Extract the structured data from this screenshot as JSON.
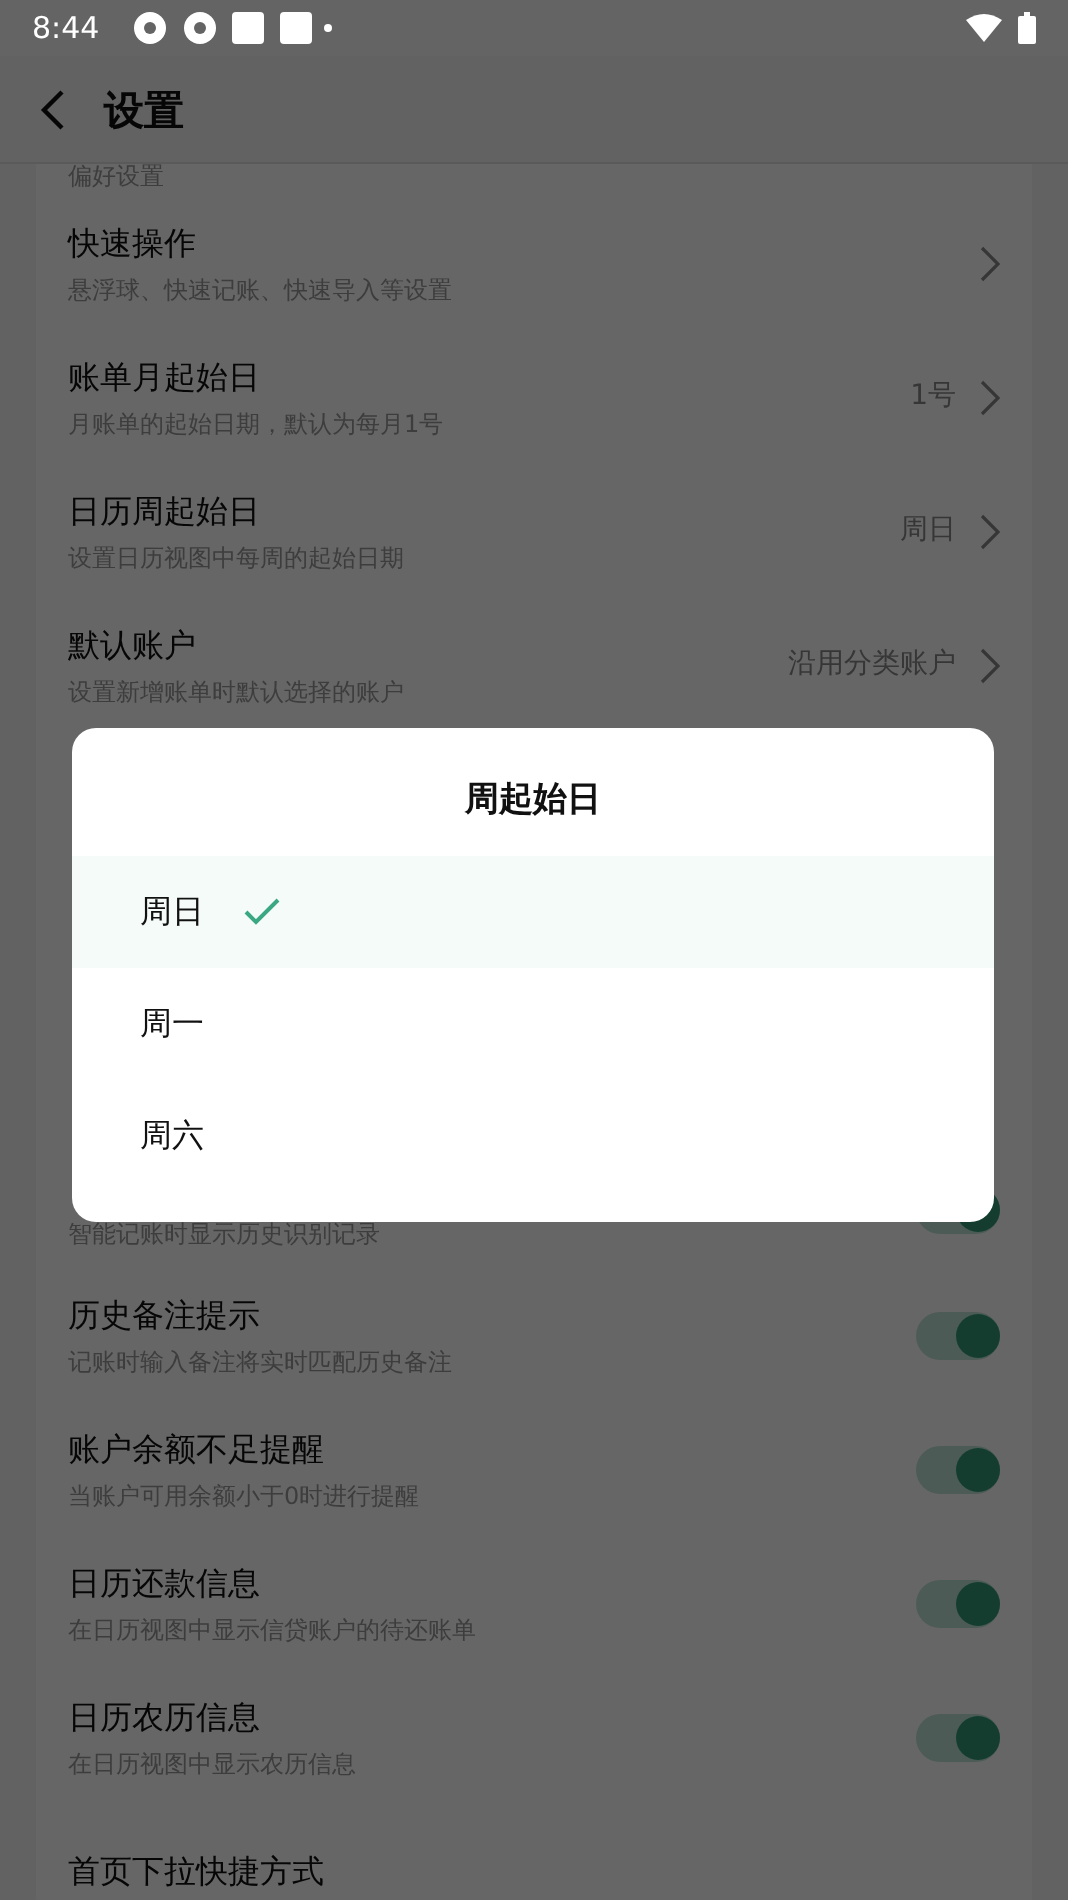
{
  "status_bar": {
    "time": "8:44"
  },
  "app_bar": {
    "title": "设置"
  },
  "section_header": "偏好设置",
  "arrow_rows": [
    {
      "title": "快速操作",
      "subtitle": "悬浮球、快速记账、快速导入等设置"
    },
    {
      "title": "账单月起始日",
      "subtitle": "月账单的起始日期，默认为每月1号",
      "value": "1号"
    },
    {
      "title": "日历周起始日",
      "subtitle": "设置日历视图中每周的起始日期",
      "value": "周日"
    },
    {
      "title": "默认账户",
      "subtitle": "设置新增账单时默认选择的账户",
      "value": "沿用分类账户"
    }
  ],
  "toggle_rows": [
    {
      "subtitle": "智能记账时显示历史识别记录",
      "on": true
    },
    {
      "title": "历史备注提示",
      "subtitle": "记账时输入备注将实时匹配历史备注",
      "on": true
    },
    {
      "title": "账户余额不足提醒",
      "subtitle": "当账户可用余额小于0时进行提醒",
      "on": true
    },
    {
      "title": "日历还款信息",
      "subtitle": "在日历视图中显示信贷账户的待还账单",
      "on": true
    },
    {
      "title": "日历农历信息",
      "subtitle": "在日历视图中显示农历信息",
      "on": true
    },
    {
      "title": "首页下拉快捷方式"
    }
  ],
  "dialog": {
    "title": "周起始日",
    "options": [
      {
        "label": "周日",
        "selected": true
      },
      {
        "label": "周一",
        "selected": false
      },
      {
        "label": "周六",
        "selected": false
      }
    ]
  }
}
